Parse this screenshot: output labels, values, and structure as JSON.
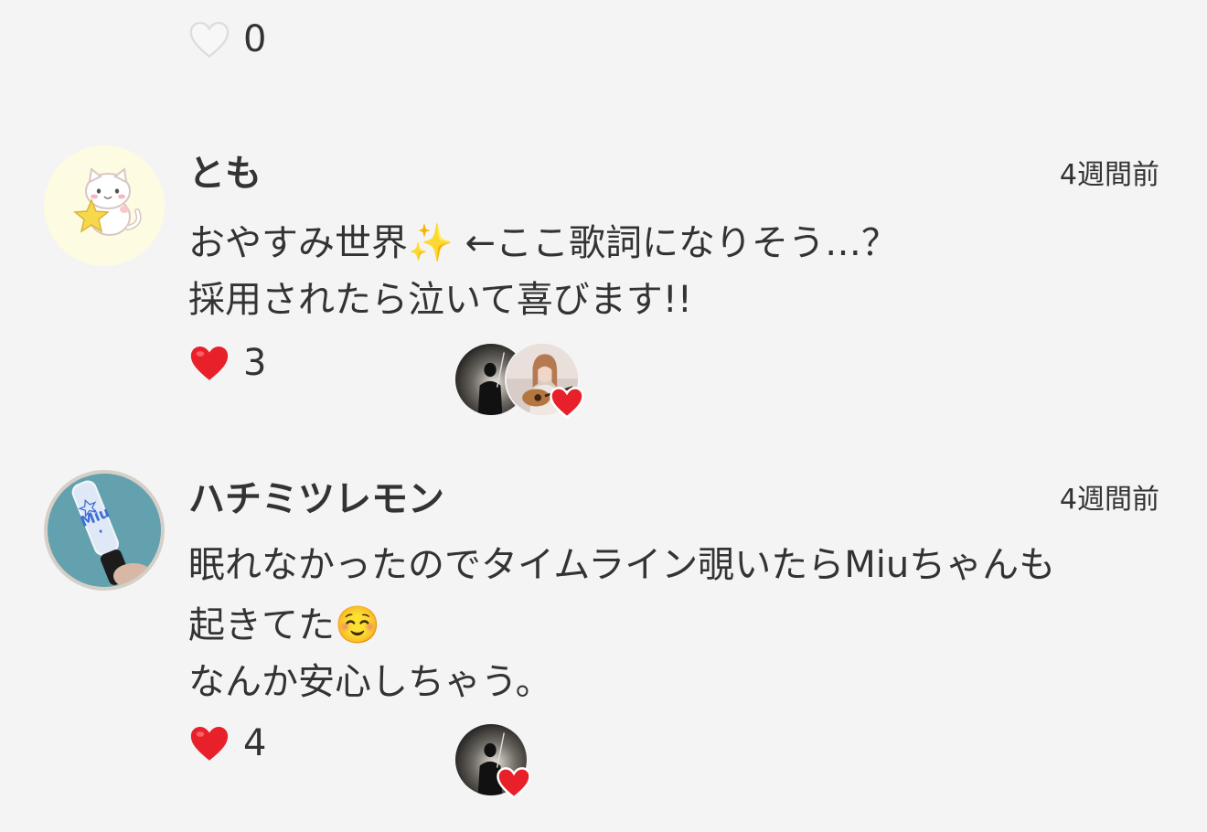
{
  "top_item": {
    "like_count": "0",
    "heart_icon": "empty-heart-icon"
  },
  "comments": [
    {
      "username": "とも",
      "time": "4週間前",
      "lines": [
        "おやすみ世界✨ ←ここ歌詞になりそう…？",
        "採用されたら泣いて喜びます!!"
      ],
      "like_count": "3",
      "heart_icon": "filled-heart-icon",
      "avatar_icon": "cat-with-star-icon"
    },
    {
      "username": "ハチミツレモン",
      "time": "4週間前",
      "lines": [
        "眠れなかったのでタイムライン覗いたらMiuちゃんも",
        "起きてた☺️",
        "なんか安心しちゃう。"
      ],
      "like_count": "4",
      "heart_icon": "filled-heart-icon",
      "avatar_icon": "penlight-miu-icon",
      "avatar_text": "Miu"
    }
  ],
  "colors": {
    "heart": "#e8202a",
    "background": "#f4f4f4",
    "text": "#333333"
  }
}
